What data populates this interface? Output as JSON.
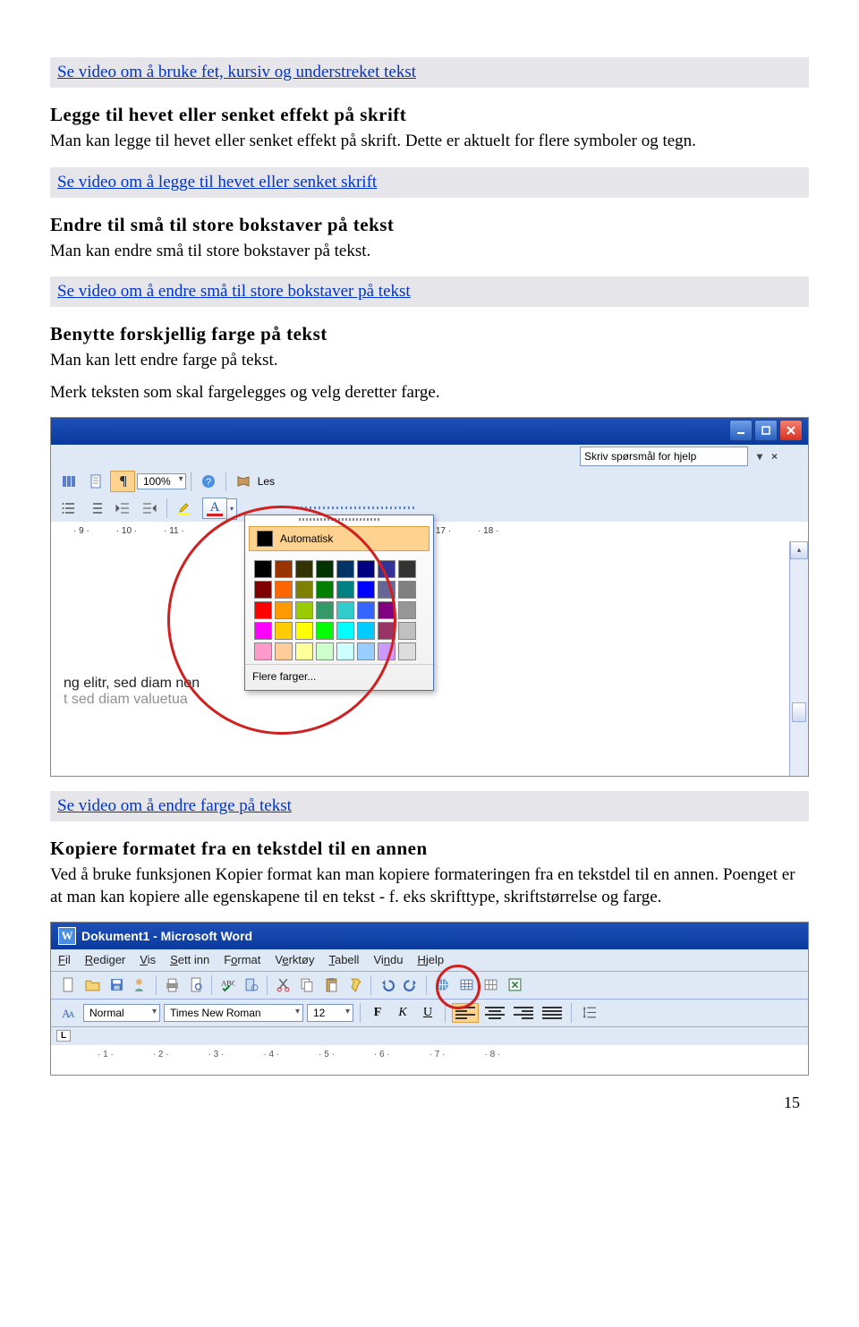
{
  "links": {
    "l1": "Se video om å bruke fet, kursiv og understreket tekst",
    "l2": "Se video om å legge til hevet eller senket skrift",
    "l3": "Se video om å endre små til store bokstaver på tekst",
    "l4": "Se video om å endre farge på tekst"
  },
  "sections": {
    "s1": {
      "h": "Legge til hevet eller senket effekt på skrift",
      "p": "Man kan legge til hevet eller senket effekt på skrift. Dette er aktuelt for flere symboler og tegn."
    },
    "s2": {
      "h": "Endre til små til store bokstaver på tekst",
      "p": "Man kan endre små til store bokstaver på tekst."
    },
    "s3": {
      "h": "Benytte forskjellig farge på tekst",
      "p1": "Man kan lett endre farge på tekst.",
      "p2": "Merk teksten som skal fargelegges og velg deretter farge."
    },
    "s4": {
      "h": "Kopiere formatet fra en tekstdel til en annen",
      "p": "Ved å bruke funksjonen Kopier format kan man kopiere formateringen fra en tekstdel til en annen. Poenget er at man kan kopiere alle egenskapene til en tekst - f. eks skrifttype, skriftstørrelse og farge."
    }
  },
  "fig1": {
    "help_placeholder": "Skriv spørsmål for hjelp",
    "zoom": "100%",
    "les": "Les",
    "ruler": [
      "· 9 ·",
      "· 10 ·",
      "· 11 ·",
      "· 17 ·",
      "· 18 ·"
    ],
    "popup_auto": "Automatisk",
    "popup_more": "Flere farger...",
    "colors": [
      "#000000",
      "#993300",
      "#333300",
      "#003300",
      "#003366",
      "#000080",
      "#333399",
      "#333333",
      "#800000",
      "#ff6600",
      "#808000",
      "#008000",
      "#008080",
      "#0000ff",
      "#666699",
      "#808080",
      "#ff0000",
      "#ff9900",
      "#99cc00",
      "#339966",
      "#33cccc",
      "#3366ff",
      "#800080",
      "#969696",
      "#ff00ff",
      "#ffcc00",
      "#ffff00",
      "#00ff00",
      "#00ffff",
      "#00ccff",
      "#993366",
      "#c0c0c0",
      "#ff99cc",
      "#ffcc99",
      "#ffff99",
      "#ccffcc",
      "#ccffff",
      "#99ccff",
      "#cc99ff",
      "#dddddd"
    ],
    "doctext1": "ng elitr, sed diam non",
    "doctext2": "t   sed diam  valuetua"
  },
  "fig2": {
    "title": "Dokument1 - Microsoft Word",
    "menu": [
      "Fil",
      "Rediger",
      "Vis",
      "Sett inn",
      "Format",
      "Verktøy",
      "Tabell",
      "Vindu",
      "Hjelp"
    ],
    "menu_ul": [
      "F",
      "R",
      "V",
      "S",
      "o",
      "e",
      "T",
      "n",
      "H"
    ],
    "style": "Normal",
    "font": "Times New Roman",
    "size": "12",
    "b": "F",
    "i": "K",
    "u": "U",
    "tag": "L",
    "ruler": [
      "1",
      "2",
      "3",
      "4",
      "5",
      "6",
      "7",
      "8"
    ]
  },
  "pagenum": "15"
}
